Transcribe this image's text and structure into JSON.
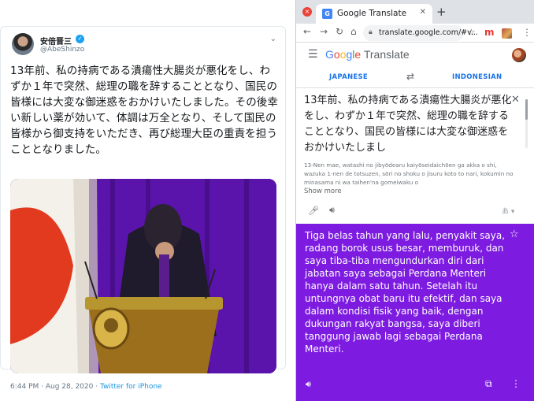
{
  "tweet": {
    "author_name": "安倍晋三",
    "handle": "@AbeShinzo",
    "text": "13年前、私の持病である潰瘍性大腸炎が悪化をし、わずか１年で突然、総理の職を辞することとなり、国民の皆様には大変な御迷惑をおかけいたしました。その後幸い新しい薬が効いて、体調は万全となり、そして国民の皆様から御支持をいただき、再び総理大臣の重責を担うこととなりました。",
    "timestamp": "6:44 PM · Aug 28, 2020 · ",
    "source": "Twitter for iPhone",
    "colors": {
      "link": "#1b95e0",
      "verified": "#1da1f2"
    }
  },
  "browser": {
    "tab_title": "Google Translate",
    "url": "translate.google.com/#v..."
  },
  "translate": {
    "logo_google": "Google",
    "logo_product": "Translate",
    "source_lang": "JAPANESE",
    "target_lang": "INDONESIAN",
    "source_text": "13年前、私の持病である潰瘍性大腸炎が悪化をし、わずか１年で突然、総理の職を辞することとなり、国民の皆様には大変な御迷惑をおかけいたしまし",
    "transliteration": "13-Nen mae, watashi no jibyōdearu kaiyōseidaichōen ga akka o shi, wazuka 1-nen de totsuzen, sōri no shoku o jisuru koto to nari, kokumin no minasama ni wa taihen'na gomeiwaku o",
    "show_more": "Show more",
    "keyboard_label": "あ",
    "result_text": "Tiga belas tahun yang lalu, penyakit saya, radang borok usus besar, memburuk, dan saya tiba-tiba mengundurkan diri dari jabatan saya sebagai Perdana Menteri hanya dalam satu tahun. Setelah itu untungnya obat baru itu efektif, dan saya dalam kondisi fisik yang baik, dengan dukungan rakyat bangsa, saya diberi tanggung jawab lagi sebagai Perdana Menteri.",
    "colors": {
      "accent": "#1a73e8",
      "result_bg": "#7d1be0"
    }
  }
}
